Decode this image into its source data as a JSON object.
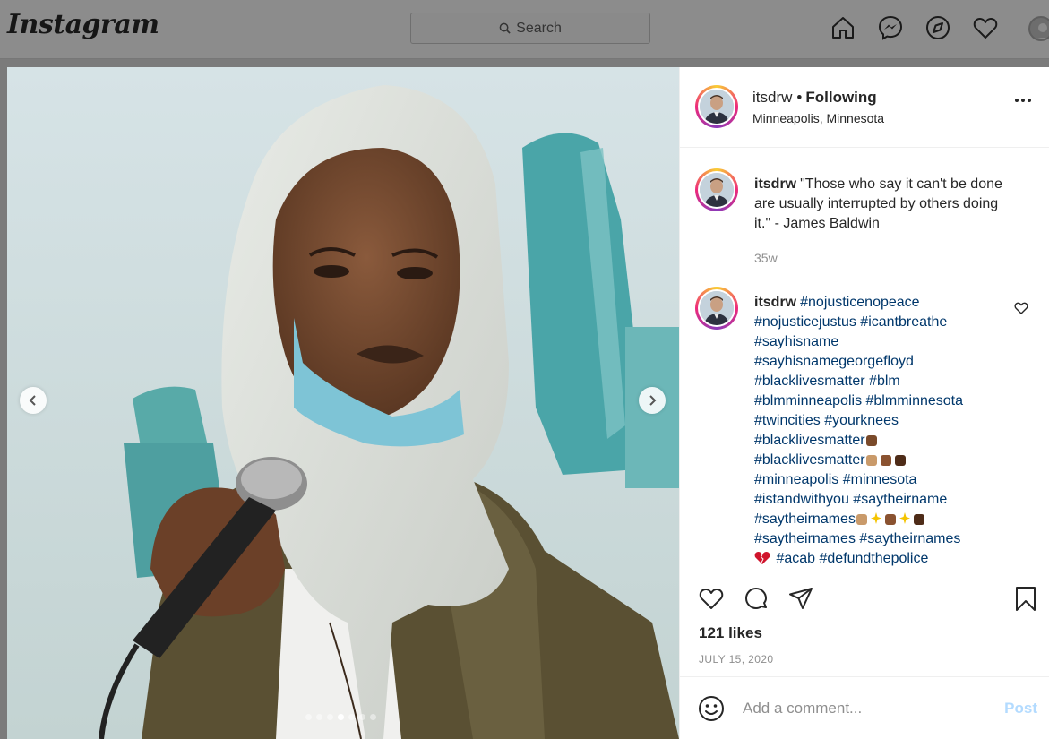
{
  "nav": {
    "logo": "Instagram",
    "search_placeholder": "Search",
    "icons": [
      "home-icon",
      "messenger-icon",
      "explore-icon",
      "activity-heart-icon",
      "profile-avatar"
    ]
  },
  "post": {
    "username": "itsdrw",
    "separator": "•",
    "follow_status": "Following",
    "location": "Minneapolis, Minnesota",
    "carousel": {
      "slides": 7,
      "active_index": 3
    },
    "caption": {
      "username": "itsdrw",
      "text": "\"Those who say it can't be done are usually interrupted by others doing it.\" - James Baldwin",
      "time": "35w"
    },
    "comment": {
      "username": "itsdrw",
      "lines": [
        "#nojusticenopeace",
        "#nojusticejustus #icantbreathe",
        "#sayhisname",
        "#sayhisnamegeorgefloyd",
        "#blacklivesmatter #blm",
        "#blmminneapolis #blmminnesota",
        "#twincities #yourknees",
        "#blacklivesmatter",
        "#blacklivesmatter",
        "#minneapolis #minnesota",
        "#istandwithyou #saytheirname",
        "#saytheirnames",
        "#saytheirnames #saytheirnames",
        "#acab #defundthepolice"
      ]
    },
    "likes": "121 likes",
    "date": "JULY 15, 2020",
    "comment_placeholder": "Add a comment...",
    "post_button": "Post"
  },
  "colors": {
    "link": "#00376b",
    "text": "#262626",
    "muted": "#8e8e8e",
    "post_disabled": "#b3dbff"
  }
}
